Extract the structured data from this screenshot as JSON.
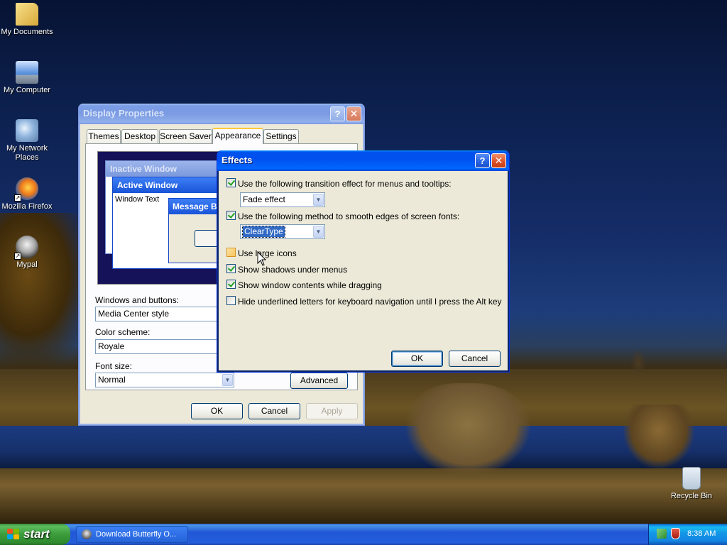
{
  "desktop": {
    "icons": [
      {
        "label": "My Documents",
        "icon": "folder-documents-icon"
      },
      {
        "label": "My Computer",
        "icon": "computer-icon"
      },
      {
        "label": "My Network Places",
        "icon": "network-places-icon"
      },
      {
        "label": "Mozilla Firefox",
        "icon": "firefox-icon"
      },
      {
        "label": "Mypal",
        "icon": "mypal-icon"
      },
      {
        "label": "Recycle Bin",
        "icon": "recycle-bin-icon"
      }
    ]
  },
  "display_properties": {
    "title": "Display Properties",
    "help_button": "?",
    "close_button": "✕",
    "tabs": [
      "Themes",
      "Desktop",
      "Screen Saver",
      "Appearance",
      "Settings"
    ],
    "active_tab": "Appearance",
    "preview": {
      "inactive_title": "Inactive Window",
      "active_title": "Active Window",
      "window_text": "Window Text",
      "message_box_title": "Message B"
    },
    "windows_and_buttons_label": "Windows and buttons:",
    "windows_and_buttons_value": "Media Center style",
    "color_scheme_label": "Color scheme:",
    "color_scheme_value": "Royale",
    "font_size_label": "Font size:",
    "font_size_value": "Normal",
    "advanced_button": "Advanced",
    "ok_button": "OK",
    "cancel_button": "Cancel",
    "apply_button": "Apply"
  },
  "effects": {
    "title": "Effects",
    "help_button": "?",
    "close_button": "✕",
    "transition_checkbox": {
      "label": "Use the following transition effect for menus and tooltips:",
      "checked": true
    },
    "transition_value": "Fade effect",
    "smooth_checkbox": {
      "label": "Use the following method to smooth edges of screen fonts:",
      "checked": true
    },
    "smooth_value": "ClearType",
    "large_icons_checkbox": {
      "label": "Use large icons",
      "checked": false
    },
    "shadows_checkbox": {
      "label": "Show shadows under menus",
      "checked": true
    },
    "drag_contents_checkbox": {
      "label": "Show window contents while dragging",
      "checked": true
    },
    "hide_underlined_checkbox": {
      "label": "Hide underlined letters for keyboard navigation until I press the Alt key",
      "checked": false
    },
    "ok_button": "OK",
    "cancel_button": "Cancel"
  },
  "taskbar": {
    "start_label": "start",
    "task_item": "Download Butterfly O...",
    "clock": "8:38 AM"
  },
  "colors": {
    "xp_title_blue": "#0053ee",
    "xp_dialog_bg": "#ece9d8",
    "start_green": "#3c9c3c",
    "tray_blue": "#1396e6",
    "selection_blue": "#316ac5"
  }
}
